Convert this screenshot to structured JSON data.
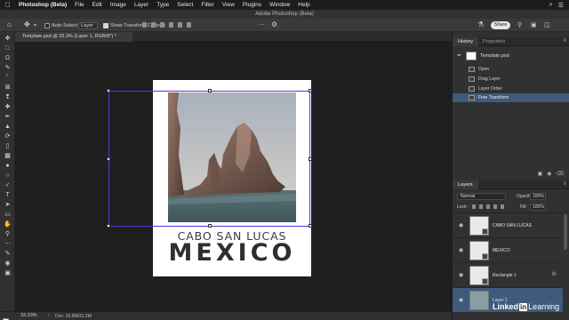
{
  "menubar": {
    "apple_icon": "apple-logo",
    "app_name": "Photoshop (Beta)",
    "items": [
      "File",
      "Edit",
      "Image",
      "Layer",
      "Type",
      "Select",
      "Filter",
      "View",
      "Plugins",
      "Window",
      "Help"
    ]
  },
  "window": {
    "title": "Adobe Photoshop (Beta)"
  },
  "options": {
    "auto_select_label": "Auto-Select:",
    "auto_select_checked": false,
    "auto_select_target": "Layer",
    "transform_label": "Show Transform Controls",
    "transform_checked": true,
    "share_label": "Share"
  },
  "document": {
    "tab_label": "Template.psd @ 33.3% (Layer 1, RGB/8*) *",
    "heading_small": "CABO SAN LUCAS",
    "heading_large": "MEXICO"
  },
  "status": {
    "zoom": "33.33%",
    "doc_size": "Doc: 20.6M/31.2M"
  },
  "history": {
    "tabs": [
      "History",
      "Properties"
    ],
    "snapshot": "Template.psd",
    "items": [
      {
        "label": "Open",
        "selected": false
      },
      {
        "label": "Drag Layer",
        "selected": false
      },
      {
        "label": "Layer Order",
        "selected": false
      },
      {
        "label": "Free Transform",
        "selected": true
      }
    ]
  },
  "layers": {
    "tab": "Layers",
    "blend_mode": "Normal",
    "opacity_label": "Opacity:",
    "opacity_value": "100%",
    "lock_label": "Lock:",
    "fill_label": "Fill:",
    "fill_value": "100%",
    "items": [
      {
        "name": "CABO SAN LUCAS",
        "selected": false,
        "fx": false
      },
      {
        "name": "MEXICO",
        "selected": false,
        "fx": false
      },
      {
        "name": "Rectangle 1",
        "selected": false,
        "fx": true
      },
      {
        "name": "Layer 1",
        "selected": true,
        "fx": false
      }
    ]
  },
  "watermark": {
    "brand": "Linked",
    "in": "in",
    "tail": "Learning"
  },
  "colors": {
    "selection_blue": "#3f5a7b",
    "transform_box": "#4b3dd3",
    "foreground": "#f2f2f2",
    "background": "#111111"
  }
}
